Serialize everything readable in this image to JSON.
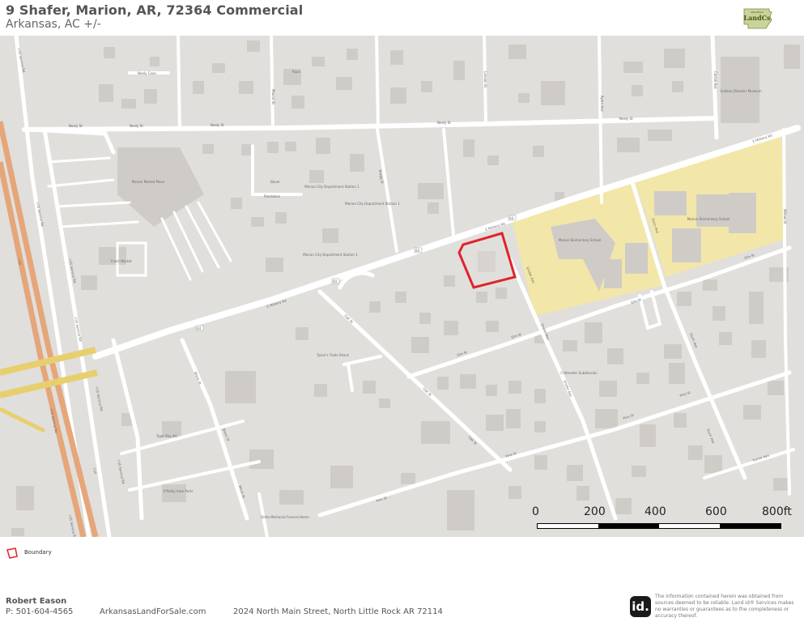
{
  "header": {
    "title": "9 Shafer, Marion, AR, 72364 Commercial",
    "subtitle": "Arkansas,  AC +/-"
  },
  "logo": {
    "icon": "arkansas-landcs-logo",
    "text": "LandCs",
    "small_text": "ARKANSAS"
  },
  "map": {
    "street_labels": {
      "e_military_rd": "E Military Rd",
      "neely_st": "Neely St",
      "elm_st": "Elm St",
      "pine_st": "Pine St",
      "oak_st": "Oak St",
      "shafer_ave": "Shafer Ave",
      "i55_service_rd": "I-55 Service Rd",
      "i55": "I-55",
      "neely_cove": "Neely Cove",
      "plantation": "Plantation",
      "mound_st": "Mound St",
      "carroll_ave": "Carroll Ave",
      "dunn_ave": "Dunn Ave",
      "ayers_ave": "Ayers Ave",
      "lanoan_st": "Lanoan St",
      "turner_ave": "Turner Ave",
      "willow_st": "Willow St",
      "bragg_st": "Bragg St",
      "block_st": "Block St"
    },
    "poi_labels": {
      "marion_market_place": "Marion Market Place",
      "fresh_market": "Fresh Market",
      "ripin": "Ripin",
      "bauer": "Bauer",
      "marion_city_dept_1": "Marion City Department Station 1",
      "marion_city_dept_2": "Marion City Department Station 1",
      "marion_city_dept_3": "Marion City Department Station 1",
      "marion_elementary_1": "Marion Elementary School",
      "marion_elementary_2": "Marion Elementary School",
      "sultana_disaster_museum": "Sultana Disaster Museum",
      "tyson_trade_shack": "Tyson's Trade Shack",
      "crittenden_subdivision": "Crittenden Subdivision",
      "tiger_bay": "Tiger Bay #C",
      "o_reilly": "O'Reilly Auto Parts",
      "funeral_home": "Delta Memorial Funeral Home"
    },
    "route_shields": [
      "64",
      "64",
      "64",
      "64"
    ],
    "colors": {
      "background": "#e0dfdc",
      "road": "#ffffff",
      "building": "#cfccc8",
      "school": "#f2e7a8",
      "interstate": "#e5a67a",
      "highway": "#e8cf6e",
      "boundary": "#e0232b"
    },
    "boundary_color": "#e0232b"
  },
  "scale": {
    "labels": [
      "0",
      "200",
      "400",
      "600",
      "800ft"
    ]
  },
  "legend": {
    "icon": "boundary-polygon-icon",
    "label": "Boundary"
  },
  "footer": {
    "name": "Robert Eason",
    "phone": "P: 501-604-4565",
    "site": "ArkansasLandForSale.com",
    "address": "2024 North Main Street, North Little Rock AR 72114",
    "badge": "id.",
    "badge_icon": "land-id-logo",
    "disclaimer": "The information contained herein was obtained from sources deemed to be reliable. Land id® Services makes no warranties or guarantees as to the completeness or accuracy thereof."
  }
}
